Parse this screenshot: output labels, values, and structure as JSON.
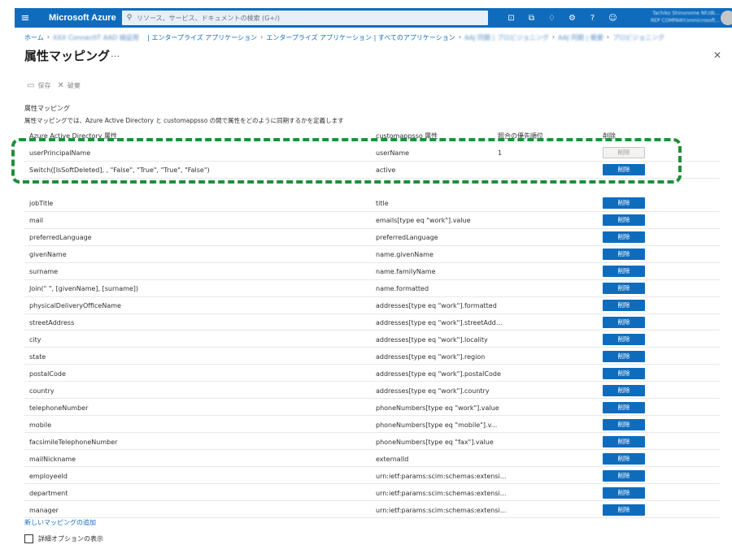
{
  "topbar": {
    "brand": "Microsoft Azure",
    "search_placeholder": "リソース、サービス、ドキュメントの検索 (G+/)",
    "account_line1": "Tachiko Shinonome NF/dk...",
    "account_line2": "REP COMPANY.onmicrosoft..."
  },
  "breadcrumb": [
    {
      "label": "ホーム",
      "blurred": false
    },
    {
      "label": "XXX ConnectIT AAD 検証用",
      "blurred": true
    },
    {
      "label": "| エンタープライズ アプリケーション",
      "blurred": false
    },
    {
      "label": "エンタープライズ アプリケーション | すべてのアプリケーション",
      "blurred": false
    },
    {
      "label": "AAJ 同期 | プロビジョニング",
      "blurred": true
    },
    {
      "label": "AAJ 同期 | 概要",
      "blurred": true
    },
    {
      "label": "プロビジョニング",
      "blurred": true
    }
  ],
  "page": {
    "title": "属性マッピング",
    "more": "…",
    "close": "✕"
  },
  "toolbar": {
    "save_label": "保存",
    "discard_label": "破棄"
  },
  "section": {
    "title": "属性マッピング",
    "description": "属性マッピングでは、Azure Active Directory と customappsso の間で属性をどのように同期するかを定義します"
  },
  "table": {
    "headers": [
      "Azure Active Directory 属性",
      "customappsso 属性",
      "照合の優先順位",
      "削除"
    ],
    "rows": [
      {
        "source": "userPrincipalName",
        "target": "userName",
        "priority": "1",
        "delete": "削除",
        "delete_enabled": false
      },
      {
        "source": "Switch([IsSoftDeleted], , \"False\", \"True\", \"True\", \"False\")",
        "target": "active",
        "priority": "",
        "delete": "削除",
        "delete_enabled": true
      },
      {
        "source": "jobTitle",
        "target": "title",
        "priority": "",
        "delete": "削除",
        "delete_enabled": true
      },
      {
        "source": "mail",
        "target": "emails[type eq \"work\"].value",
        "priority": "",
        "delete": "削除",
        "delete_enabled": true
      },
      {
        "source": "preferredLanguage",
        "target": "preferredLanguage",
        "priority": "",
        "delete": "削除",
        "delete_enabled": true
      },
      {
        "source": "givenName",
        "target": "name.givenName",
        "priority": "",
        "delete": "削除",
        "delete_enabled": true
      },
      {
        "source": "surname",
        "target": "name.familyName",
        "priority": "",
        "delete": "削除",
        "delete_enabled": true
      },
      {
        "source": "Join(\" \", [givenName], [surname])",
        "target": "name.formatted",
        "priority": "",
        "delete": "削除",
        "delete_enabled": true
      },
      {
        "source": "physicalDeliveryOfficeName",
        "target": "addresses[type eq \"work\"].formatted",
        "priority": "",
        "delete": "削除",
        "delete_enabled": true
      },
      {
        "source": "streetAddress",
        "target": "addresses[type eq \"work\"].streetAdd...",
        "priority": "",
        "delete": "削除",
        "delete_enabled": true
      },
      {
        "source": "city",
        "target": "addresses[type eq \"work\"].locality",
        "priority": "",
        "delete": "削除",
        "delete_enabled": true
      },
      {
        "source": "state",
        "target": "addresses[type eq \"work\"].region",
        "priority": "",
        "delete": "削除",
        "delete_enabled": true
      },
      {
        "source": "postalCode",
        "target": "addresses[type eq \"work\"].postalCode",
        "priority": "",
        "delete": "削除",
        "delete_enabled": true
      },
      {
        "source": "country",
        "target": "addresses[type eq \"work\"].country",
        "priority": "",
        "delete": "削除",
        "delete_enabled": true
      },
      {
        "source": "telephoneNumber",
        "target": "phoneNumbers[type eq \"work\"].value",
        "priority": "",
        "delete": "削除",
        "delete_enabled": true
      },
      {
        "source": "mobile",
        "target": "phoneNumbers[type eq \"mobile\"].v...",
        "priority": "",
        "delete": "削除",
        "delete_enabled": true
      },
      {
        "source": "facsimileTelephoneNumber",
        "target": "phoneNumbers[type eq \"fax\"].value",
        "priority": "",
        "delete": "削除",
        "delete_enabled": true
      },
      {
        "source": "mailNickname",
        "target": "externalId",
        "priority": "",
        "delete": "削除",
        "delete_enabled": true
      },
      {
        "source": "employeeId",
        "target": "urn:ietf:params:scim:schemas:extensi...",
        "priority": "",
        "delete": "削除",
        "delete_enabled": true
      },
      {
        "source": "department",
        "target": "urn:ietf:params:scim:schemas:extensi...",
        "priority": "",
        "delete": "削除",
        "delete_enabled": true
      },
      {
        "source": "manager",
        "target": "urn:ietf:params:scim:schemas:extensi...",
        "priority": "",
        "delete": "削除",
        "delete_enabled": true
      }
    ]
  },
  "footer": {
    "add_mapping": "新しいマッピングの追加",
    "advanced_options": "詳細オプションの表示"
  },
  "colors": {
    "azure_blue": "#0f6cbd",
    "highlight_green": "#1f8f3a"
  }
}
